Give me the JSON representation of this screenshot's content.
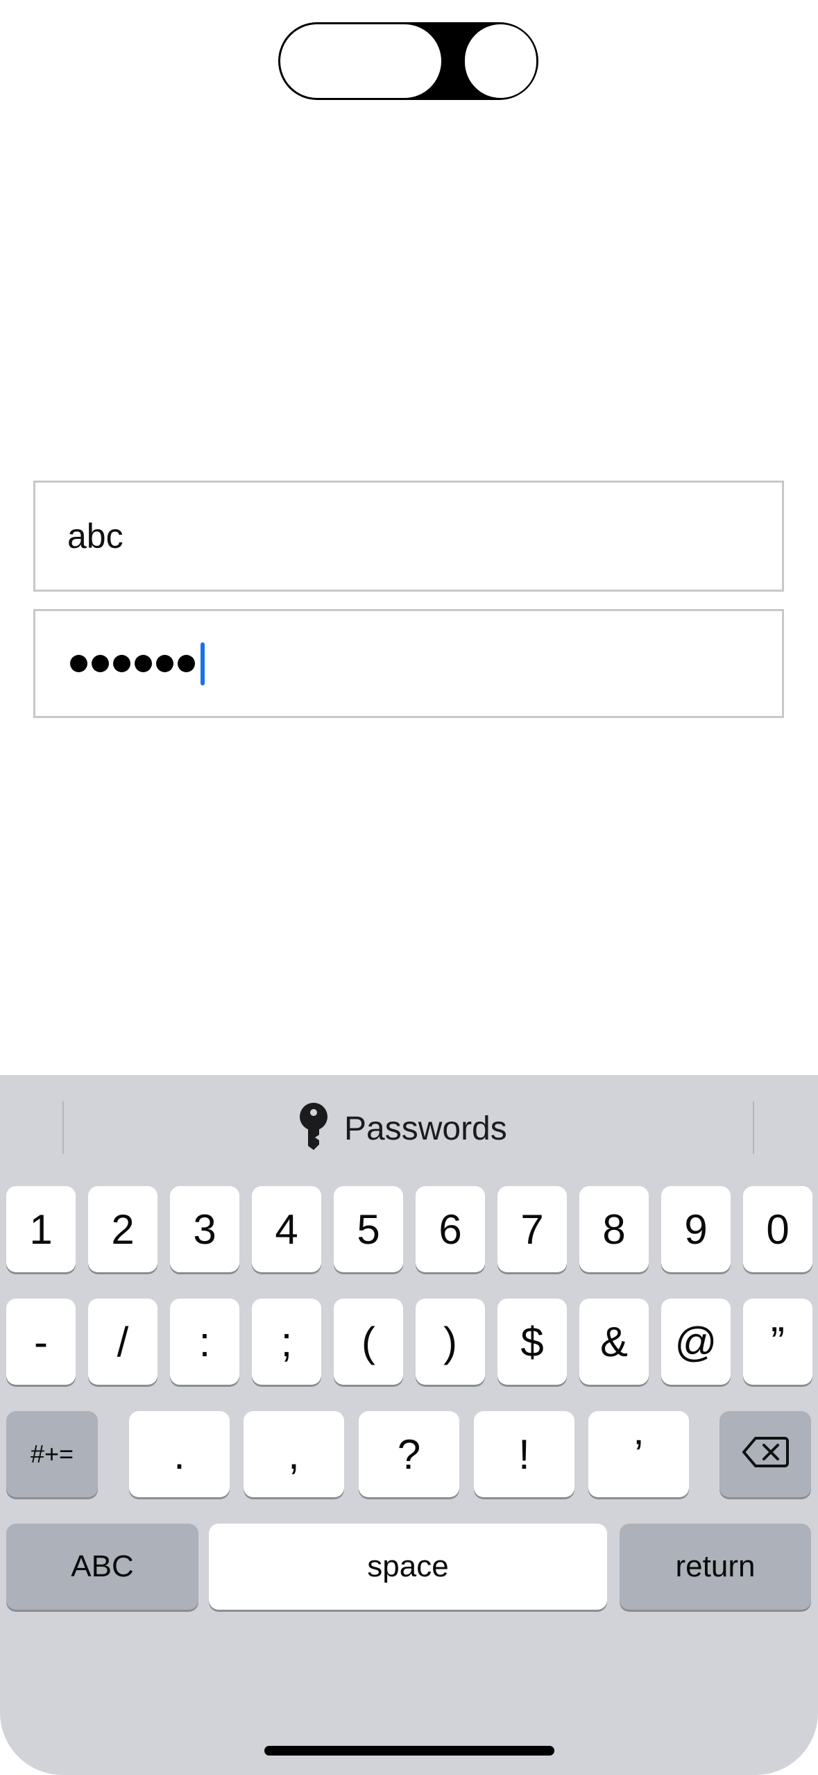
{
  "login": {
    "username_value": "abc",
    "password_mask_count": 6
  },
  "keyboard": {
    "suggestion_label": "Passwords",
    "row1": [
      "1",
      "2",
      "3",
      "4",
      "5",
      "6",
      "7",
      "8",
      "9",
      "0"
    ],
    "row2": [
      "-",
      "/",
      ":",
      ";",
      "(",
      ")",
      "$",
      "&",
      "@",
      "”"
    ],
    "row3": {
      "shift_label": "#+=",
      "keys": [
        ".",
        ",",
        "?",
        "!",
        "’"
      ],
      "delete_icon": "delete-backward-icon"
    },
    "row4": {
      "abc_label": "ABC",
      "space_label": "space",
      "return_label": "return"
    }
  },
  "icons": {
    "suggestion_icon": "key-icon"
  },
  "colors": {
    "keyboard_bg": "#d1d3d9",
    "caret": "#1a73e8",
    "dark_key": "#acb1ba"
  }
}
